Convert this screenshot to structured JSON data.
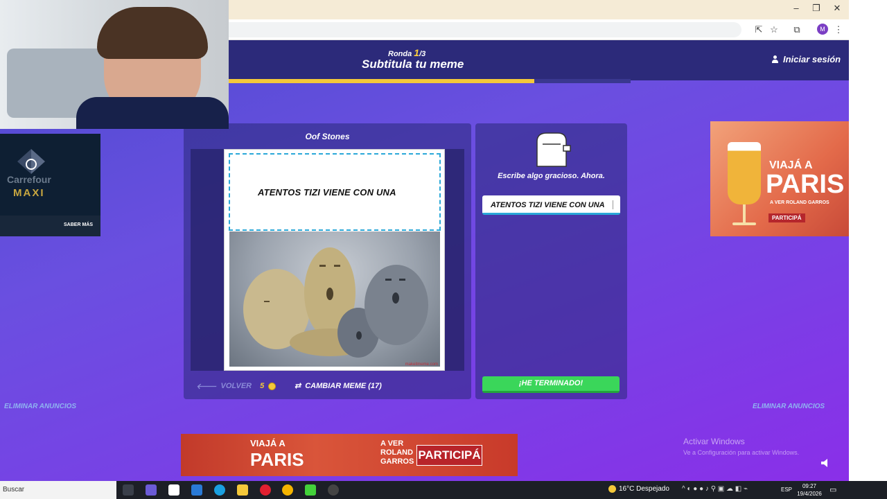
{
  "browser": {
    "minimize": "–",
    "restore": "❐",
    "close": "✕",
    "profile_initial": "M"
  },
  "header": {
    "round_prefix": "Ronda ",
    "round_current": "1",
    "round_total": "/3",
    "title": "Subtitula tu meme",
    "login_label": "Iniciar sesión",
    "progress_fraction": 0.76
  },
  "meme": {
    "name": "Oof Stones",
    "caption": "ATENTOS TIZI VIENE CON UNA",
    "watermark": "makeitmeme.com",
    "back_label": "VOLVER",
    "points": "5",
    "change_label": "CAMBIAR MEME (17)"
  },
  "writer": {
    "prompt": "Escribe algo gracioso. Ahora.",
    "input_value": "ATENTOS TIZI VIENE CON UNA",
    "done_label": "¡HE TERMINADO!"
  },
  "ads": {
    "left_brand": "Carrefour",
    "left_sub": "MAXI",
    "left_cta": "SABER MÁS",
    "right_title": "VIAJÁ A",
    "right_city": "PARIS",
    "right_sub": "A VER ROLAND GARROS",
    "right_cta": "PARTICIPÁ",
    "remove_ads": "ELIMINAR ANUNCIOS",
    "bottom_a": "VIAJÁ A",
    "bottom_city": "PARIS",
    "bottom_b": "A VER ROLAND GARROS",
    "bottom_cta": "PARTICIPÁ"
  },
  "windows": {
    "activate_title": "Activar Windows",
    "activate_sub": "Ve a Configuración para activar Windows."
  },
  "taskbar": {
    "search_label": "Buscar",
    "weather": "16°C  Despejado",
    "lang": "ESP",
    "time": "09:27",
    "date": "19/4/2026"
  }
}
